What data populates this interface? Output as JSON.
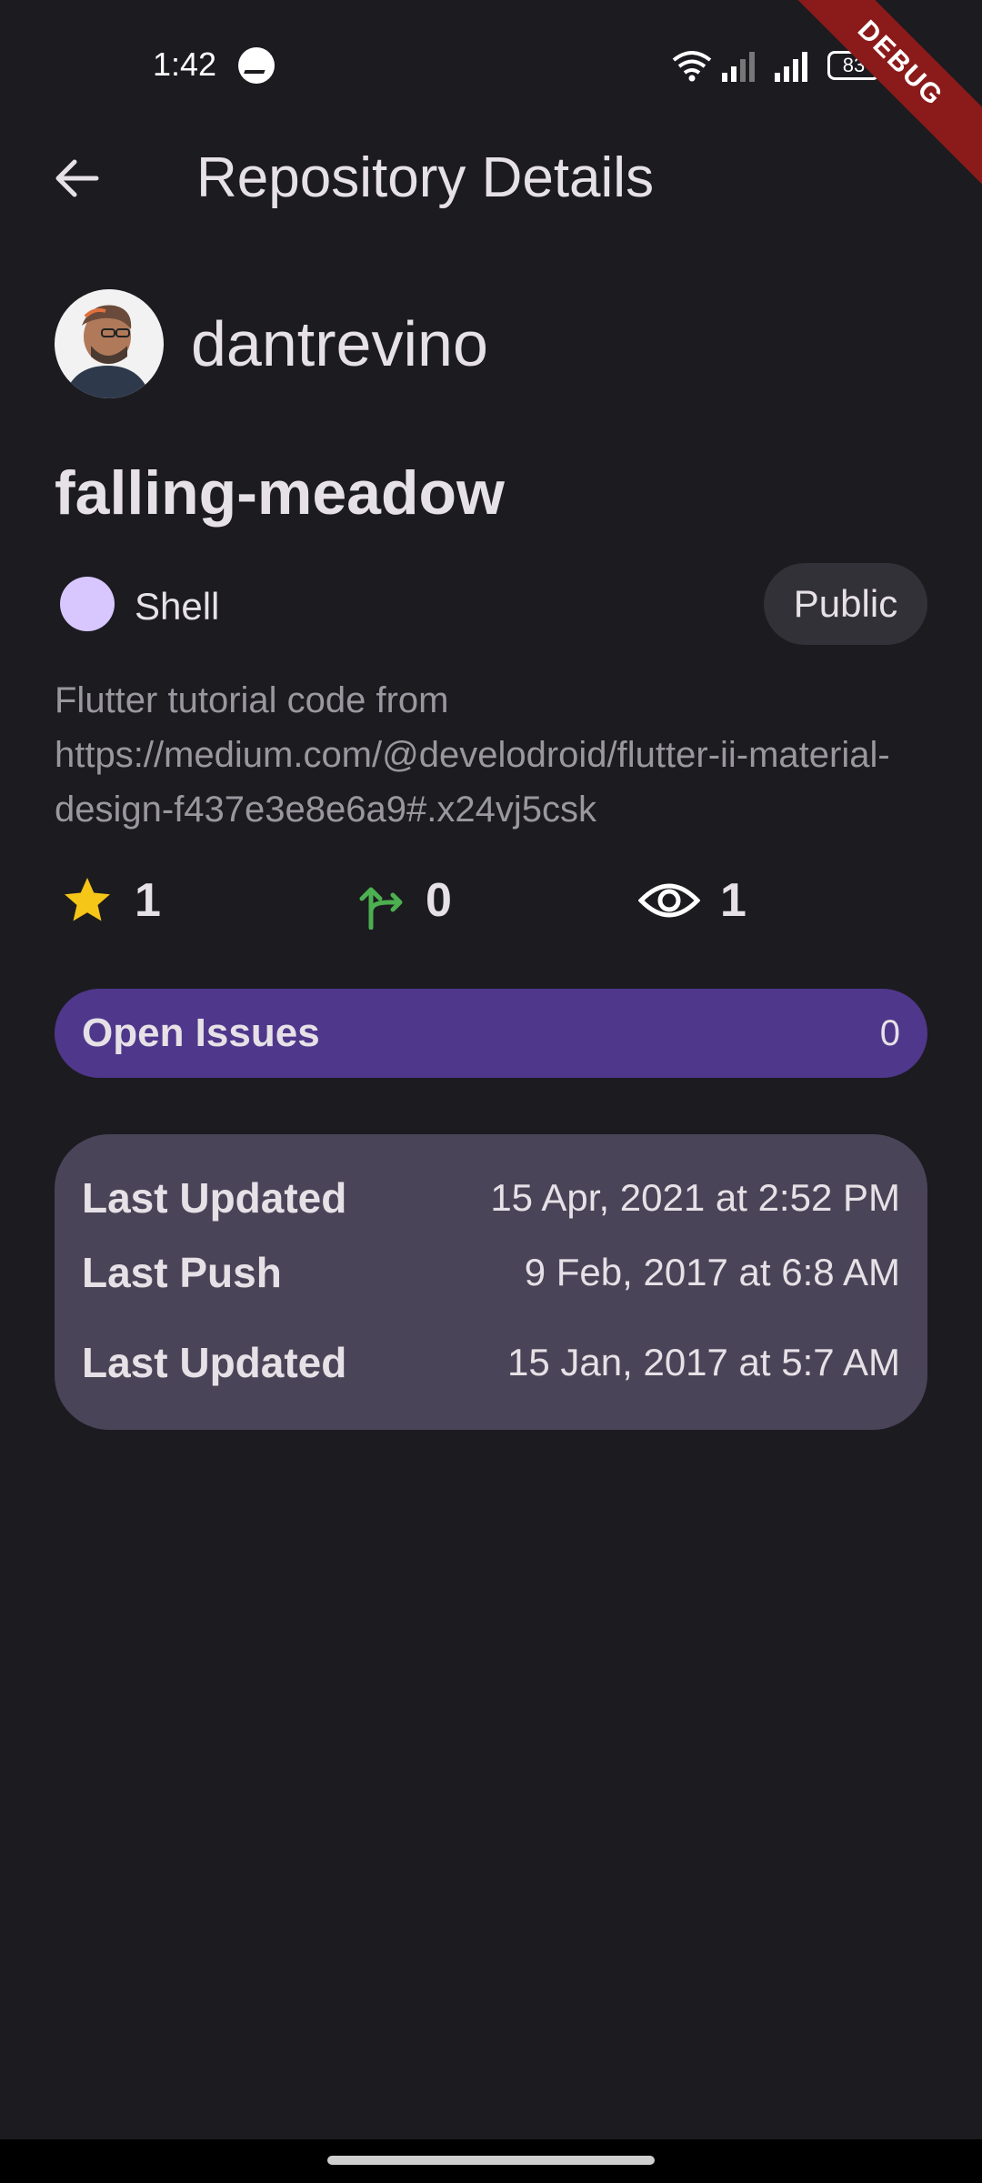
{
  "status_bar": {
    "time": "1:42",
    "battery": "83",
    "icons": [
      "messenger-icon",
      "wifi-icon",
      "signal-icon",
      "signal-icon",
      "battery-icon"
    ]
  },
  "debug_banner": "DEBUG",
  "app_bar": {
    "title": "Repository Details",
    "back_icon": "arrow-back-icon"
  },
  "owner": {
    "login": "dantrevino",
    "avatar_icon": "avatar"
  },
  "repo": {
    "name": "falling-meadow",
    "language": "Shell",
    "language_color": "#d8c6ff",
    "visibility": "Public",
    "description": "Flutter tutorial code from https://medium.com/@develodroid/flutter-ii-material-design-f437e3e8e6a9#.x24vj5csk"
  },
  "stats": {
    "stars": "1",
    "forks": "0",
    "watchers": "1",
    "star_color": "#f5c518",
    "fork_color": "#4caf50"
  },
  "issues": {
    "label": "Open Issues",
    "count": "0"
  },
  "dates": [
    {
      "label": "Last Updated",
      "value": "15 Apr, 2021 at 2:52 PM"
    },
    {
      "label": "Last Push",
      "value": "9 Feb, 2017 at 6:8 AM"
    },
    {
      "label": "Last Updated",
      "value": "15 Jan, 2017 at 5:7 AM"
    }
  ],
  "colors": {
    "background": "#1c1b20",
    "issues_bar": "#4f378b",
    "dates_card": "#4a4458",
    "chip": "#333138"
  }
}
